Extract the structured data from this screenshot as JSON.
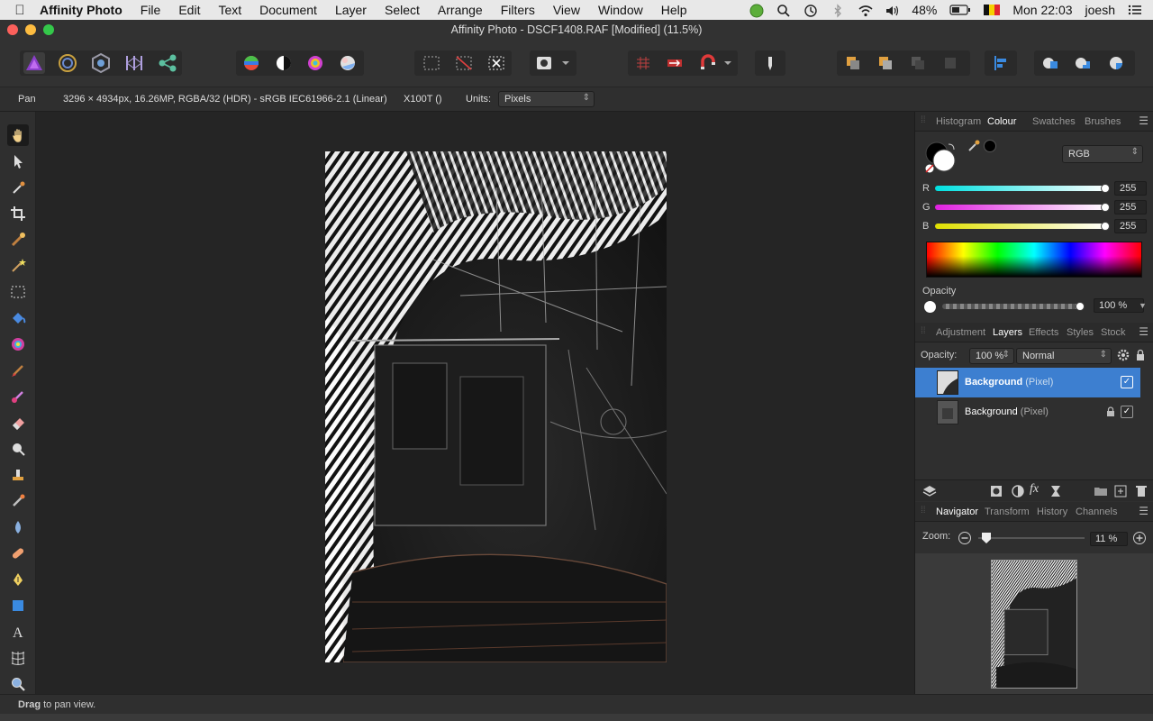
{
  "menubar": {
    "app": "Affinity Photo",
    "items": [
      "File",
      "Edit",
      "Text",
      "Document",
      "Layer",
      "Select",
      "Arrange",
      "Filters",
      "View",
      "Window",
      "Help"
    ],
    "battery": "48%",
    "clock": "Mon 22:03",
    "user": "joesh"
  },
  "window": {
    "title": "Affinity Photo - DSCF1408.RAF [Modified] (11.5%)"
  },
  "context": {
    "tool": "Pan",
    "doc_info": "3296 × 4934px, 16.26MP, RGBA/32 (HDR) - sRGB IEC61966-2.1 (Linear)",
    "camera": "X100T ()",
    "units_label": "Units:",
    "units_value": "Pixels"
  },
  "colour_panel": {
    "tabs": [
      "Histogram",
      "Colour",
      "Swatches",
      "Brushes"
    ],
    "active_tab": "Colour",
    "model": "RGB",
    "channels": [
      {
        "label": "R",
        "value": "255"
      },
      {
        "label": "G",
        "value": "255"
      },
      {
        "label": "B",
        "value": "255"
      }
    ],
    "opacity_label": "Opacity",
    "opacity_value": "100 %"
  },
  "layers_panel": {
    "tabs": [
      "Adjustment",
      "Layers",
      "Effects",
      "Styles",
      "Stock"
    ],
    "active_tab": "Layers",
    "opacity_label": "Opacity:",
    "opacity_value": "100 %",
    "blend_mode": "Normal",
    "layers": [
      {
        "name": "Background",
        "type": "(Pixel)",
        "selected": true,
        "locked": false,
        "visible": true
      },
      {
        "name": "Background",
        "type": "(Pixel)",
        "selected": false,
        "locked": true,
        "visible": true
      }
    ]
  },
  "navigator_panel": {
    "tabs": [
      "Navigator",
      "Transform",
      "History",
      "Channels"
    ],
    "active_tab": "Navigator",
    "zoom_label": "Zoom:",
    "zoom_value": "11 %"
  },
  "statusbar": {
    "bold": "Drag",
    "text": " to pan view."
  },
  "colors": {
    "accent": "#3d7fd0",
    "panel_bg": "#2f2f2f",
    "canvas_bg": "#252525"
  }
}
